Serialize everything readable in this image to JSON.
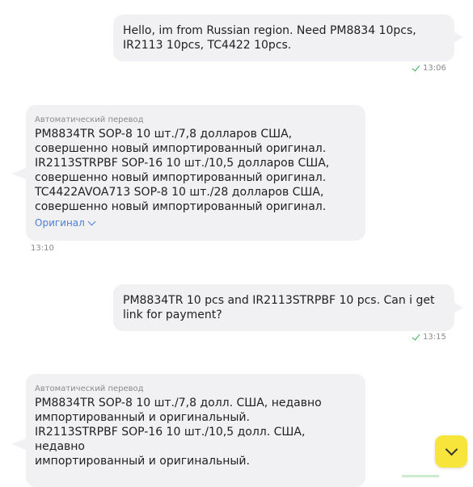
{
  "messages": [
    {
      "direction": "outgoing",
      "text": "Hello, im from Russian region. Need PM8834 10pcs,\nIR2113 10pcs, TC4422 10pcs.",
      "time": "13:06",
      "status": "read"
    },
    {
      "direction": "incoming",
      "auto_label": "Автоматический перевод",
      "text": "PM8834TR SOP-8 10 шт./7,8 долларов США,\nсовершенно новый импортированный оригинал.\nIR2113STRPBF SOP-16 10 шт./10,5 долларов США,\nсовершенно новый импортированный оригинал.\nTC4422AVOA713 SOP-8 10 шт./28 долларов США,\nсовершенно новый импортированный оригинал.",
      "original_link": "Оригинал",
      "time": "13:10"
    },
    {
      "direction": "outgoing",
      "text": "PM8834TR 10 pcs and IR2113STRPBF 10 pcs. Can i get\nlink for payment?",
      "time": "13:15",
      "status": "read"
    },
    {
      "direction": "incoming",
      "auto_label": "Автоматический перевод",
      "text": "PM8834TR SOP-8 10 шт./7,8 долл. США, недавно\nимпортированный и оригинальный.\nIR2113STRPBF SOP-16 10 шт./10,5 долл. США, недавно\nимпортированный и оригинальный."
    }
  ],
  "scroll_button": {
    "icon": "chevron-down-icon"
  },
  "colors": {
    "bubble_bg": "#f1f1f4",
    "check_green": "#2fa94e",
    "link_blue": "#4a7fd6",
    "scroll_button_yellow": "#f7e53b"
  }
}
